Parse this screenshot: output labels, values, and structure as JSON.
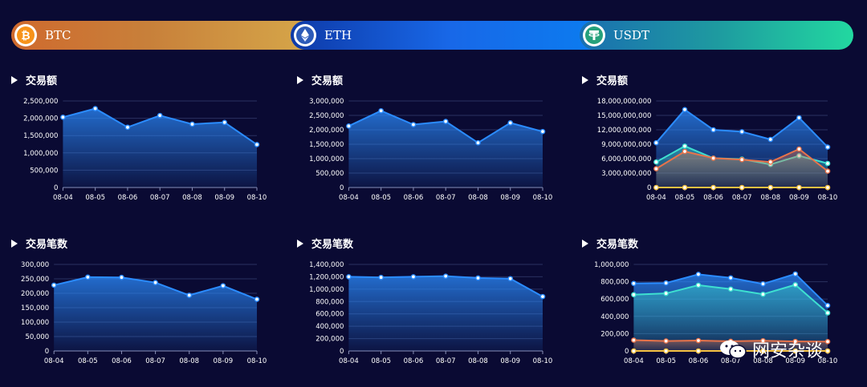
{
  "tabs": [
    {
      "label": "BTC",
      "icon": "bitcoin-icon"
    },
    {
      "label": "ETH",
      "icon": "ethereum-icon"
    },
    {
      "label": "USDT",
      "icon": "tether-icon"
    }
  ],
  "sections": {
    "volume_title": "交易额",
    "count_title": "交易笔数"
  },
  "watermark": {
    "text": "网安杂谈"
  },
  "colors": {
    "primary": "#2b8cff",
    "teal": "#3ee0d0",
    "orange": "#e8734a",
    "yellow": "#f5c142"
  },
  "chart_data": [
    {
      "type": "area",
      "id": "btc-volume",
      "title": "交易额",
      "categories": [
        "08-04",
        "08-05",
        "08-06",
        "08-07",
        "08-08",
        "08-09",
        "08-10"
      ],
      "yticks": [
        "0",
        "500,000",
        "1,000,000",
        "1,500,000",
        "2,000,000",
        "2,500,000"
      ],
      "ylim": [
        0,
        2500000
      ],
      "series": [
        {
          "values": [
            2030000,
            2280000,
            1740000,
            2080000,
            1830000,
            1880000,
            1240000
          ]
        }
      ]
    },
    {
      "type": "area",
      "id": "eth-volume",
      "title": "交易额",
      "categories": [
        "08-04",
        "08-05",
        "08-06",
        "08-07",
        "08-08",
        "08-09",
        "08-10"
      ],
      "yticks": [
        "0",
        "500,000",
        "1,000,000",
        "1,500,000",
        "2,000,000",
        "2,500,000",
        "3,000,000"
      ],
      "ylim": [
        0,
        3000000
      ],
      "series": [
        {
          "values": [
            2130000,
            2660000,
            2180000,
            2290000,
            1550000,
            2240000,
            1940000
          ]
        }
      ]
    },
    {
      "type": "area",
      "id": "usdt-volume",
      "title": "交易额",
      "categories": [
        "08-04",
        "08-05",
        "08-06",
        "08-07",
        "08-08",
        "08-09",
        "08-10"
      ],
      "yticks": [
        "0",
        "3,000,000,000",
        "6,000,000,000",
        "9,000,000,000",
        "12,000,000,000",
        "15,000,000,000",
        "18,000,000,000"
      ],
      "ylim": [
        0,
        18000000000
      ],
      "series": [
        {
          "values": [
            9300000000,
            16200000000,
            12000000000,
            11600000000,
            10000000000,
            14500000000,
            8400000000
          ]
        },
        {
          "values": [
            5300000000,
            8600000000,
            6100000000,
            5900000000,
            4800000000,
            6600000000,
            5000000000
          ]
        },
        {
          "values": [
            3900000000,
            7500000000,
            6100000000,
            5800000000,
            5300000000,
            8000000000,
            3400000000
          ]
        },
        {
          "values": [
            0,
            0,
            0,
            0,
            0,
            0,
            0
          ]
        }
      ]
    },
    {
      "type": "area",
      "id": "btc-count",
      "title": "交易笔数",
      "categories": [
        "08-04",
        "08-05",
        "08-06",
        "08-07",
        "08-08",
        "08-09",
        "08-10"
      ],
      "yticks": [
        "0",
        "50,000",
        "100,000",
        "150,000",
        "200,000",
        "250,000",
        "300,000"
      ],
      "ylim": [
        0,
        300000
      ],
      "series": [
        {
          "values": [
            228000,
            256000,
            255000,
            237000,
            193000,
            226000,
            179000
          ]
        }
      ]
    },
    {
      "type": "area",
      "id": "eth-count",
      "title": "交易笔数",
      "categories": [
        "08-04",
        "08-05",
        "08-06",
        "08-07",
        "08-08",
        "08-09",
        "08-10"
      ],
      "yticks": [
        "0",
        "200,000",
        "400,000",
        "600,000",
        "800,000",
        "1,000,000",
        "1,200,000",
        "1,400,000"
      ],
      "ylim": [
        0,
        1400000
      ],
      "series": [
        {
          "values": [
            1200000,
            1190000,
            1200000,
            1210000,
            1180000,
            1170000,
            880000
          ]
        }
      ]
    },
    {
      "type": "area",
      "id": "usdt-count",
      "title": "交易笔数",
      "categories": [
        "08-04",
        "08-05",
        "08-06",
        "08-07",
        "08-08",
        "08-09",
        "08-10"
      ],
      "yticks": [
        "0",
        "200,000",
        "400,000",
        "600,000",
        "800,000",
        "1,000,000"
      ],
      "ylim": [
        0,
        1000000
      ],
      "series": [
        {
          "values": [
            780000,
            785000,
            885000,
            845000,
            775000,
            890000,
            525000
          ]
        },
        {
          "values": [
            650000,
            665000,
            760000,
            715000,
            655000,
            765000,
            440000
          ]
        },
        {
          "values": [
            125000,
            115000,
            120000,
            112000,
            118000,
            110000,
            108000
          ]
        },
        {
          "values": [
            0,
            0,
            0,
            0,
            0,
            0,
            0
          ]
        }
      ]
    }
  ]
}
